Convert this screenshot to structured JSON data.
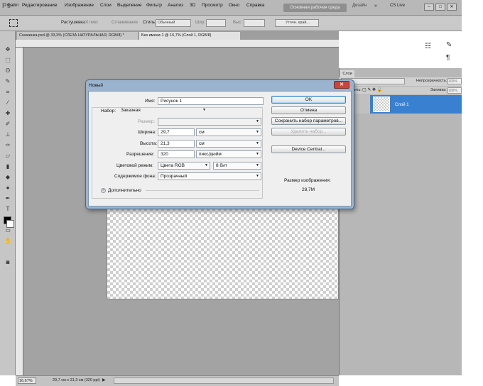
{
  "app": {
    "logo": "Ps",
    "menu": [
      "Файл",
      "Редактирование",
      "Изображение",
      "Слои",
      "Выделение",
      "Фильтр",
      "Анализ",
      "3D",
      "Просмотр",
      "Окно",
      "Справка"
    ],
    "workspace_button": "Основная рабочая среда",
    "design_button": "Дизайн",
    "cs_live": "CS Live",
    "window_controls": [
      "–",
      "□",
      "✕"
    ]
  },
  "options_bar": {
    "feather_label": "Растушевка:",
    "feather_value": "0 пикс",
    "antialias_label": "Сглаживание",
    "style_label": "Стиль:",
    "style_value": "Обычный",
    "width_label": "Шир:",
    "height_label": "Выс:",
    "refine_button": "Уточн. край..."
  },
  "tabs": [
    {
      "label": "Снежинка.psd @ 33,3% (СЛЕЗА НАТУРАЛЬНАЯ, RGB/8) *"
    },
    {
      "label": "Без имени-1 @ 16,7% (Слой 1, RGB/8)"
    }
  ],
  "layers_panel": {
    "tab": "Слои",
    "opacity_label": "Непрозрачность:",
    "opacity_value": "100%",
    "lock_label": "Закрепить:",
    "fill_label": "Заливка:",
    "fill_value": "100%",
    "layer_name": "Слой 1"
  },
  "status": {
    "zoom": "16,67%",
    "doc_info": "29,7 см x 21,3 см (320 ppi)",
    "arrow": "▶"
  },
  "dialog": {
    "title": "Новый",
    "close": "✕",
    "name_label": "Имя:",
    "name_value": "Рисунок 1",
    "preset_label": "Набор:",
    "preset_value": "Заказная",
    "size_label": "Размер:",
    "width_label": "Ширина:",
    "width_value": "29,7",
    "width_unit": "см",
    "height_label": "Высота:",
    "height_value": "21,3",
    "height_unit": "см",
    "resolution_label": "Разрешение:",
    "resolution_value": "320",
    "resolution_unit": "пикс/дюйм",
    "color_mode_label": "Цветовой режим:",
    "color_mode_value": "Цвета RGB",
    "bit_depth": "8 бит",
    "background_label": "Содержимое фона:",
    "background_value": "Прозрачный",
    "advanced_label": "Дополнительно",
    "buttons": {
      "ok": "OK",
      "cancel": "Отмена",
      "save_preset": "Сохранить набор параметров...",
      "delete_preset": "Удалить набор...",
      "device_central": "Device Central..."
    },
    "image_size_label": "Размер изображения:",
    "image_size_value": "28,7M"
  },
  "colors": {
    "accent": "#3a80d0",
    "dialog_frame": "#9ab4cf"
  }
}
